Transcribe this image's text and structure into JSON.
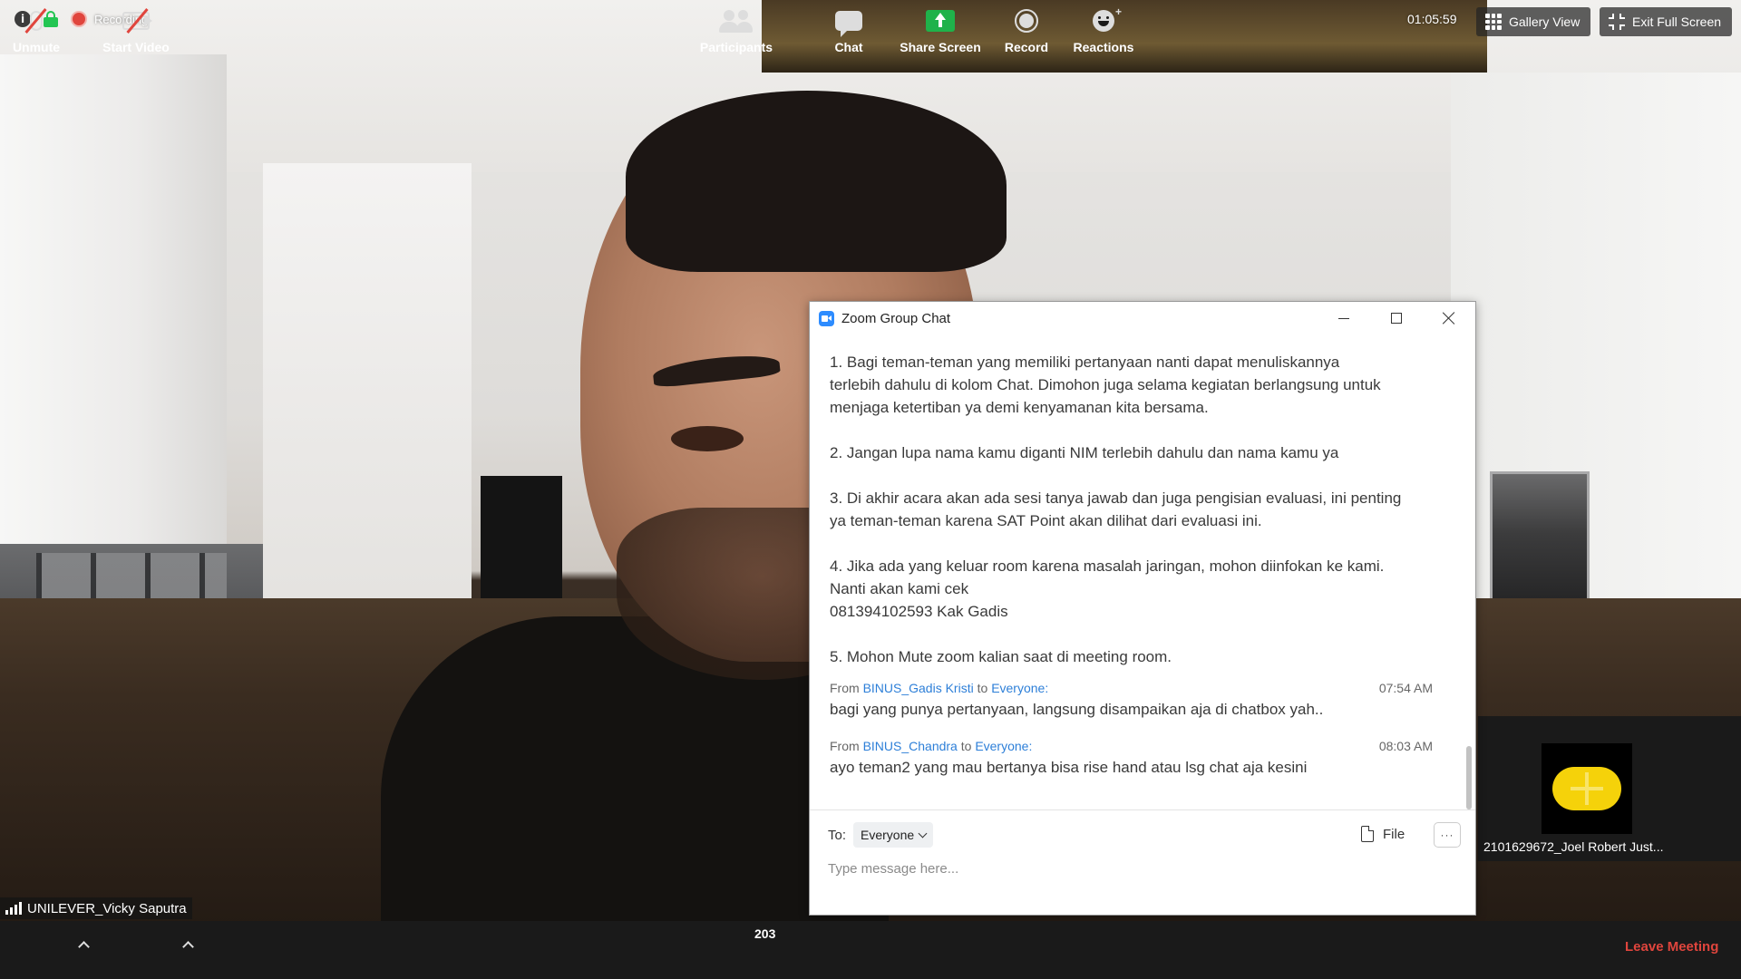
{
  "topbar": {
    "recording_label": "Recording",
    "timer": "01:05:59",
    "gallery_view_label": "Gallery View",
    "exit_fullscreen_label": "Exit Full Screen"
  },
  "speaker": {
    "name": "UNILEVER_Vicky Saputra"
  },
  "thumbnail": {
    "name": "2101629672_Joel Robert Just..."
  },
  "chat": {
    "window_title": "Zoom Group Chat",
    "announcement": [
      [
        "1. Bagi teman-teman yang memiliki pertanyaan nanti dapat menuliskannya",
        "terlebih dahulu di kolom Chat. Dimohon juga selama kegiatan berlangsung untuk",
        "menjaga ketertiban ya demi kenyamanan kita bersama."
      ],
      [
        "2. Jangan lupa nama kamu diganti NIM terlebih dahulu dan nama kamu ya"
      ],
      [
        "3. Di akhir acara akan ada sesi tanya jawab dan juga pengisian evaluasi, ini penting",
        "ya teman-teman karena SAT Point akan dilihat dari evaluasi ini."
      ],
      [
        "4. Jika ada yang keluar room karena masalah jaringan, mohon diinfokan ke kami.",
        "Nanti akan kami cek",
        "081394102593 Kak Gadis"
      ],
      [
        "5. Mohon Mute zoom kalian saat di meeting room."
      ]
    ],
    "messages": [
      {
        "from_prefix": "From",
        "sender": "BINUS_Gadis Kristi",
        "to_prefix": "to",
        "recipient": "Everyone:",
        "time": "07:54 AM",
        "text": "bagi yang punya pertanyaan, langsung disampaikan aja di chatbox yah.."
      },
      {
        "from_prefix": "From",
        "sender": "BINUS_Chandra",
        "to_prefix": "to",
        "recipient": "Everyone:",
        "time": "08:03 AM",
        "text": "ayo teman2 yang mau bertanya bisa rise hand atau lsg chat aja kesini"
      }
    ],
    "to_label": "To:",
    "to_value": "Everyone",
    "file_label": "File",
    "more_label": "···",
    "input_placeholder": "Type message here..."
  },
  "toolbar": {
    "unmute_label": "Unmute",
    "start_video_label": "Start Video",
    "participants_label": "Participants",
    "participants_count": "203",
    "chat_label": "Chat",
    "share_screen_label": "Share Screen",
    "record_label": "Record",
    "reactions_label": "Reactions",
    "leave_label": "Leave Meeting"
  },
  "colors": {
    "accent_blue": "#2d8cff",
    "share_green": "#1fb24a",
    "leave_red": "#e0453d",
    "toolbar_bg": "#1a1a1a"
  }
}
